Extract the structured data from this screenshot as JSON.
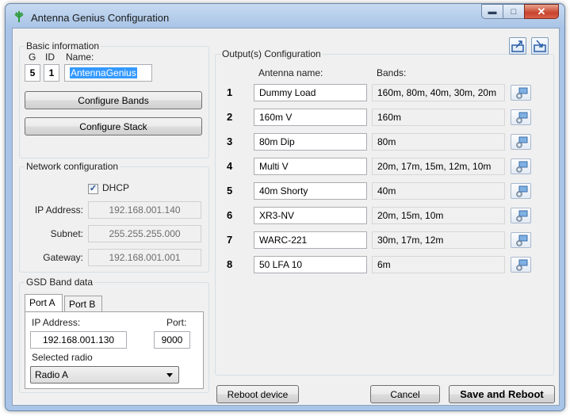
{
  "window": {
    "title": "Antenna Genius Configuration"
  },
  "basic": {
    "group_label": "Basic information",
    "g_label": "G",
    "id_label": "ID",
    "name_label": "Name:",
    "g_value": "5",
    "id_value": "1",
    "name_value": "AntennaGenius",
    "configure_bands": "Configure Bands",
    "configure_stack": "Configure Stack"
  },
  "network": {
    "group_label": "Network configuration",
    "dhcp_label": "DHCP",
    "dhcp_checked": true,
    "ip_label": "IP Address:",
    "ip_value": "192.168.001.140",
    "subnet_label": "Subnet:",
    "subnet_value": "255.255.255.000",
    "gateway_label": "Gateway:",
    "gateway_value": "192.168.001.001"
  },
  "gsd": {
    "group_label": "GSD Band data",
    "tabs": [
      "Port A",
      "Port B"
    ],
    "active_tab": "Port A",
    "ip_label": "IP Address:",
    "port_label": "Port:",
    "ip_value": "192.168.001.130",
    "port_value": "9000",
    "radio_label": "Selected radio",
    "radio_value": "Radio A"
  },
  "outputs": {
    "group_label": "Output(s) Configuration",
    "col_name": "Antenna name:",
    "col_bands": "Bands:",
    "rows": [
      {
        "num": "1",
        "name": "Dummy Load",
        "bands": "160m, 80m, 40m, 30m, 20m"
      },
      {
        "num": "2",
        "name": "160m V",
        "bands": "160m"
      },
      {
        "num": "3",
        "name": "80m Dip",
        "bands": "80m"
      },
      {
        "num": "4",
        "name": "Multi V",
        "bands": "20m, 17m, 15m, 12m, 10m"
      },
      {
        "num": "5",
        "name": "40m Shorty",
        "bands": "40m"
      },
      {
        "num": "6",
        "name": "XR3-NV",
        "bands": "20m, 15m, 10m"
      },
      {
        "num": "7",
        "name": "WARC-221",
        "bands": "30m, 17m, 12m"
      },
      {
        "num": "8",
        "name": "50 LFA 10",
        "bands": "6m"
      }
    ]
  },
  "footer": {
    "reboot": "Reboot device",
    "cancel": "Cancel",
    "save": "Save and Reboot"
  },
  "icons": {
    "row_action": "gear-settings-icon",
    "export": "export-icon",
    "import": "import-icon"
  }
}
